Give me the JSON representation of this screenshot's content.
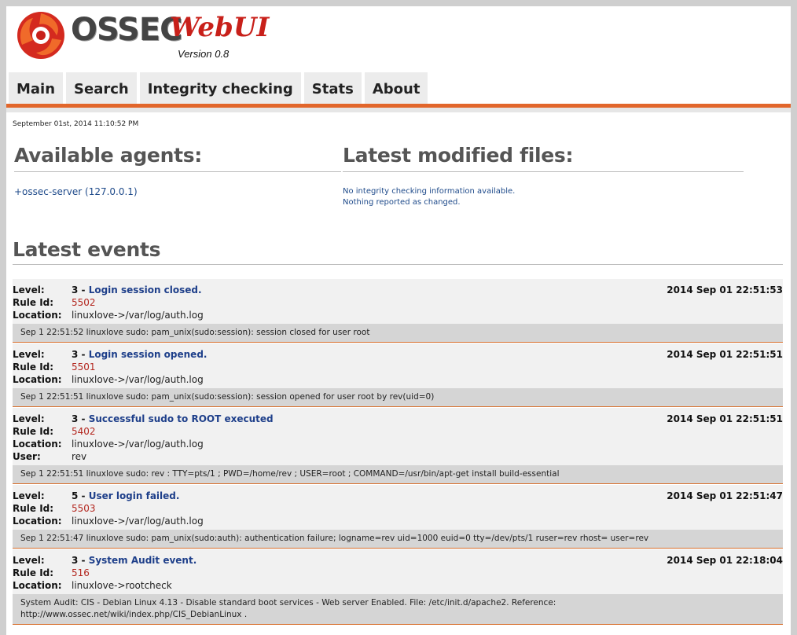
{
  "header": {
    "logo_word": "OSSEC",
    "logo_script": "WebUI",
    "version": "Version 0.8"
  },
  "nav": {
    "tabs": [
      {
        "label": "Main"
      },
      {
        "label": "Search"
      },
      {
        "label": "Integrity checking"
      },
      {
        "label": "Stats"
      },
      {
        "label": "About"
      }
    ]
  },
  "colors": {
    "accent": "#e2662b",
    "link": "#1e4a8a",
    "rule_id": "#b3261e",
    "logo_red": "#c8201a"
  },
  "main": {
    "datetime": "September 01st, 2014 11:10:52 PM",
    "agents_title": "Available agents:",
    "agent": "+ossec-server (127.0.0.1)",
    "files_title": "Latest modified files:",
    "files_msg_1": "No integrity checking information available.",
    "files_msg_2": "Nothing reported as changed.",
    "events_title": "Latest events"
  },
  "events": [
    {
      "level_label": "Level:",
      "level": "3",
      "sep": " - ",
      "description": "Login session closed.",
      "time": "2014 Sep 01 22:51:53",
      "rule_label": "Rule Id:",
      "rule_id": "5502",
      "location_label": "Location:",
      "location": "linuxlove->/var/log/auth.log",
      "log": "Sep 1 22:51:52 linuxlove sudo: pam_unix(sudo:session): session closed for user root"
    },
    {
      "level_label": "Level:",
      "level": "3",
      "sep": " - ",
      "description": "Login session opened.",
      "time": "2014 Sep 01 22:51:51",
      "rule_label": "Rule Id:",
      "rule_id": "5501",
      "location_label": "Location:",
      "location": "linuxlove->/var/log/auth.log",
      "log": "Sep 1 22:51:51 linuxlove sudo: pam_unix(sudo:session): session opened for user root by rev(uid=0)"
    },
    {
      "level_label": "Level:",
      "level": "3",
      "sep": " - ",
      "description": "Successful sudo to ROOT executed",
      "time": "2014 Sep 01 22:51:51",
      "rule_label": "Rule Id:",
      "rule_id": "5402",
      "location_label": "Location:",
      "location": "linuxlove->/var/log/auth.log",
      "user_label": "User:",
      "user": "rev",
      "log": "Sep 1 22:51:51 linuxlove sudo: rev : TTY=pts/1 ; PWD=/home/rev ; USER=root ; COMMAND=/usr/bin/apt-get install build-essential"
    },
    {
      "level_label": "Level:",
      "level": "5",
      "sep": " - ",
      "description": "User login failed.",
      "time": "2014 Sep 01 22:51:47",
      "rule_label": "Rule Id:",
      "rule_id": "5503",
      "location_label": "Location:",
      "location": "linuxlove->/var/log/auth.log",
      "log": "Sep 1 22:51:47 linuxlove sudo: pam_unix(sudo:auth): authentication failure; logname=rev uid=1000 euid=0 tty=/dev/pts/1 ruser=rev rhost= user=rev"
    },
    {
      "level_label": "Level:",
      "level": "3",
      "sep": " - ",
      "description": "System Audit event.",
      "time": "2014 Sep 01 22:18:04",
      "rule_label": "Rule Id:",
      "rule_id": "516",
      "location_label": "Location:",
      "location": "linuxlove->rootcheck",
      "log": "System Audit: CIS - Debian Linux 4.13 - Disable standard boot services - Web server Enabled. File: /etc/init.d/apache2. Reference: http://www.ossec.net/wiki/index.php/CIS_DebianLinux ."
    }
  ]
}
